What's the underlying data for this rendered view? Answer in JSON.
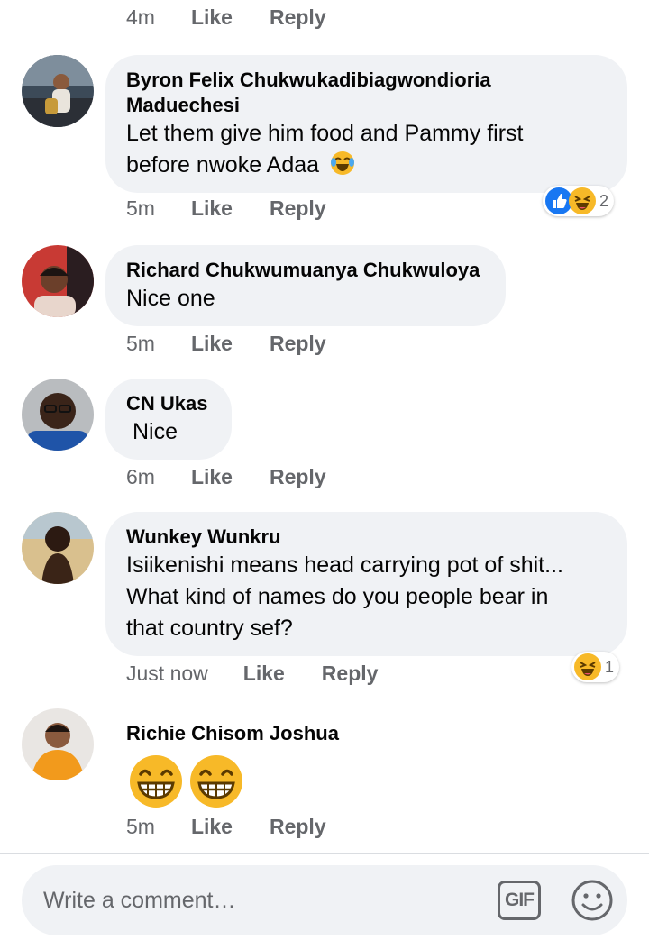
{
  "top_actions": {
    "time": "4m",
    "like": "Like",
    "reply": "Reply"
  },
  "comments": [
    {
      "author": "Byron Felix Chukwukadibiagwondioria Maduechesi",
      "author_line1": "Byron Felix Chukwukadibiagwondioria",
      "author_line2": "Maduechesi",
      "text_line1": "Let them give him food and Pammy first",
      "text_line2": "before nwoke Adaa",
      "time": "5m",
      "like": "Like",
      "reply": "Reply",
      "reactions": [
        "like",
        "haha"
      ],
      "reaction_count": "2"
    },
    {
      "author": "Richard Chukwumuanya Chukwuloya",
      "text": "Nice one",
      "time": "5m",
      "like": "Like",
      "reply": "Reply"
    },
    {
      "author": "CN Ukas",
      "text": "Nice",
      "time": "6m",
      "like": "Like",
      "reply": "Reply"
    },
    {
      "author": "Wunkey Wunkru",
      "text_line1": "Isiikenishi means head carrying pot of shit...",
      "text_line2": "What kind of names do you people bear in",
      "text_line3": "that country sef?",
      "time": "Just now",
      "like": "Like",
      "reply": "Reply",
      "reactions": [
        "haha"
      ],
      "reaction_count": "1"
    },
    {
      "author": "Richie Chisom Joshua",
      "content": "grinning-emoji x2",
      "time": "5m",
      "like": "Like",
      "reply": "Reply"
    }
  ],
  "composer": {
    "placeholder": "Write a comment…",
    "gif_label": "GIF",
    "emoji_icon": "smiley-icon"
  },
  "colors": {
    "bubble": "#f0f2f5",
    "meta": "#65676b",
    "like_blue": "#1877f2",
    "haha_yellow": "#f7b928"
  }
}
